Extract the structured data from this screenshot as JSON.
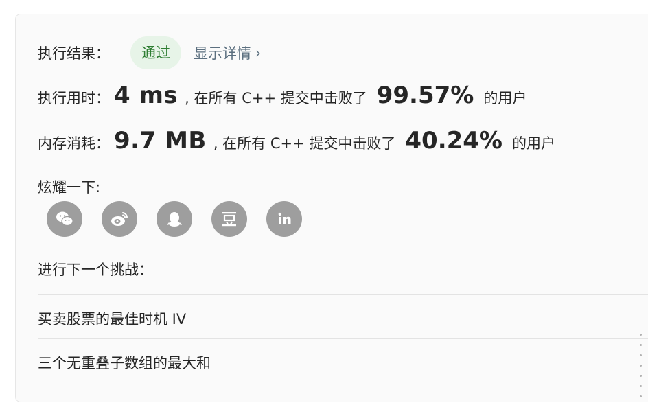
{
  "result": {
    "label": "执行结果：",
    "status": "通过",
    "details_link": "显示详情",
    "status_color": "#2e7d32",
    "status_bg": "#e7f4e8"
  },
  "runtime": {
    "label": "执行用时：",
    "value": "4 ms",
    "beat_text": ", 在所有 C++ 提交中击败了",
    "percent": "99.57%",
    "suffix": "的用户"
  },
  "memory": {
    "label": "内存消耗：",
    "value": "9.7 MB",
    "beat_text": ", 在所有 C++ 提交中击败了",
    "percent": "40.24%",
    "suffix": "的用户"
  },
  "share": {
    "label": "炫耀一下:",
    "icons": [
      "wechat-icon",
      "weibo-icon",
      "qq-icon",
      "douban-icon",
      "linkedin-icon"
    ]
  },
  "next": {
    "label": "进行下一个挑战：",
    "items": [
      "买卖股票的最佳时机 IV",
      "三个无重叠子数组的最大和"
    ]
  }
}
